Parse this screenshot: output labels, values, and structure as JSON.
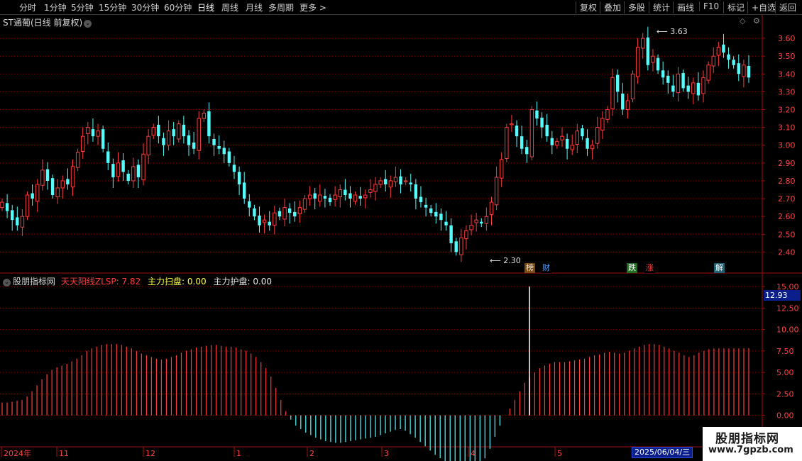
{
  "toolbar": {
    "left": [
      "分时",
      "1分钟",
      "5分钟",
      "15分钟",
      "30分钟",
      "60分钟",
      "日线",
      "周线",
      "月线",
      "多周期",
      "更多 >"
    ],
    "active": "日线",
    "right": [
      "复权",
      "叠加",
      "多股",
      "统计",
      "画线",
      "F10",
      "标记",
      "+自选",
      "返回"
    ]
  },
  "main": {
    "title": "ST通葡(日线 前复权)",
    "high_label": "3.63",
    "low_label": "2.30",
    "badges": [
      {
        "text": "榜",
        "color": "#e8e8e8",
        "bg": "#7a4a10"
      },
      {
        "text": "财",
        "color": "#4aa0ff",
        "bg": "#000"
      },
      {
        "text": "跌",
        "color": "#ffffff",
        "bg": "#1f6f1f"
      },
      {
        "text": "涨",
        "color": "#ff4040",
        "bg": "#000"
      },
      {
        "text": "解",
        "color": "#ffffff",
        "bg": "#1f5f6f"
      }
    ]
  },
  "indicator": {
    "name": "股朋指标网",
    "l1_label": "天天阳线ZLSP:",
    "l1_value": "7.82",
    "l2_label": "主力扫盘:",
    "l2_value": "0.00",
    "l3_label": "主力护盘:",
    "l3_value": "0.00",
    "current_box": "12.93"
  },
  "time_axis": {
    "labels": [
      "2024年",
      "11",
      "12",
      "1",
      "2",
      "3",
      "4",
      "5"
    ],
    "cursor_date": "2025/06/04/三"
  },
  "watermark": {
    "title": "股朋指标网",
    "url": "www.7gpzb.com"
  },
  "colors": {
    "up": "#ff3c3c",
    "down": "#54fcfc",
    "grid": "#8b0000",
    "spike": "#ffffff"
  },
  "chart_data": [
    {
      "type": "candlestick",
      "title": "ST通葡(日线 前复权)",
      "y_ticks": [
        2.4,
        2.5,
        2.6,
        2.7,
        2.8,
        2.9,
        3.0,
        3.1,
        3.2,
        3.3,
        3.4,
        3.5,
        3.6
      ],
      "ylim": [
        2.29,
        3.68
      ],
      "max_point": 3.63,
      "min_point": 2.3,
      "close": [
        2.68,
        2.63,
        2.58,
        2.55,
        2.6,
        2.72,
        2.7,
        2.78,
        2.86,
        2.8,
        2.72,
        2.76,
        2.8,
        2.78,
        2.88,
        2.96,
        3.05,
        3.1,
        3.05,
        3.08,
        2.98,
        2.9,
        2.82,
        2.9,
        2.85,
        2.8,
        2.88,
        2.82,
        2.95,
        3.05,
        3.1,
        3.05,
        3.0,
        3.08,
        3.05,
        3.12,
        3.05,
        3.0,
        2.98,
        3.15,
        3.18,
        3.05,
        3.0,
        2.98,
        2.95,
        2.9,
        2.85,
        2.78,
        2.7,
        2.65,
        2.6,
        2.55,
        2.58,
        2.55,
        2.62,
        2.6,
        2.65,
        2.62,
        2.6,
        2.65,
        2.7,
        2.72,
        2.7,
        2.72,
        2.7,
        2.68,
        2.72,
        2.75,
        2.72,
        2.7,
        2.72,
        2.7,
        2.72,
        2.75,
        2.78,
        2.8,
        2.78,
        2.8,
        2.82,
        2.78,
        2.8,
        2.78,
        2.7,
        2.68,
        2.65,
        2.62,
        2.6,
        2.58,
        2.55,
        2.45,
        2.4,
        2.48,
        2.52,
        2.55,
        2.58,
        2.56,
        2.6,
        2.68,
        2.82,
        2.92,
        3.1,
        3.12,
        3.05,
        2.98,
        2.95,
        3.2,
        3.15,
        3.1,
        3.05,
        3.0,
        3.02,
        3.05,
        2.98,
        3.0,
        3.08,
        3.05,
        2.98,
        3.0,
        3.1,
        3.15,
        3.2,
        3.38,
        3.3,
        3.2,
        3.25,
        3.4,
        3.55,
        3.6,
        3.45,
        3.5,
        3.42,
        3.38,
        3.35,
        3.3,
        3.4,
        3.32,
        3.3,
        3.35,
        3.28,
        3.38,
        3.45,
        3.5,
        3.55,
        3.52,
        3.48,
        3.45,
        3.4,
        3.45,
        3.38
      ]
    },
    {
      "type": "bar",
      "title": "股朋指标网",
      "y_ticks": [
        0.0,
        2.5,
        5.0,
        7.5,
        10.0,
        12.5,
        15.0
      ],
      "ylim": [
        -3.5,
        15.5
      ],
      "spike_value": 15.0,
      "values": [
        1.5,
        1.5,
        1.6,
        1.7,
        1.8,
        2.2,
        2.8,
        3.5,
        4.2,
        4.8,
        5.3,
        5.6,
        5.8,
        6.0,
        6.3,
        6.6,
        7.0,
        7.5,
        7.8,
        8.0,
        8.2,
        8.3,
        8.3,
        8.3,
        8.2,
        8.0,
        7.8,
        7.5,
        7.2,
        7.0,
        6.8,
        6.6,
        6.5,
        6.6,
        6.8,
        7.0,
        7.3,
        7.5,
        7.7,
        7.9,
        8.0,
        8.1,
        8.2,
        8.2,
        8.1,
        8.0,
        8.0,
        7.9,
        7.7,
        7.5,
        7.2,
        6.8,
        6.2,
        5.5,
        4.5,
        3.2,
        1.8,
        0.5,
        -0.5,
        -1.2,
        -1.6,
        -2.0,
        -2.3,
        -2.6,
        -2.8,
        -3.0,
        -3.1,
        -3.2,
        -3.2,
        -3.1,
        -3.0,
        -2.9,
        -2.8,
        -2.7,
        -2.6,
        -2.5,
        -2.3,
        -2.1,
        -1.9,
        -1.7,
        -1.6,
        -1.8,
        -2.2,
        -2.6,
        -3.1,
        -3.6,
        -4.1,
        -4.6,
        -5.0,
        -5.4,
        -5.8,
        -6.1,
        -6.3,
        -6.4,
        -6.4,
        -6.2,
        -5.8,
        -5.0,
        -3.9,
        -2.5,
        -1.2,
        0.0,
        0.8,
        1.8,
        2.8,
        3.8,
        4.5,
        5.0,
        5.5,
        5.8,
        6.0,
        6.2,
        6.2,
        6.2,
        6.3,
        6.4,
        6.5,
        6.6,
        6.8,
        7.0,
        7.1,
        7.3,
        7.4,
        7.3,
        7.2,
        7.3,
        7.5,
        7.8,
        8.0,
        8.2,
        8.3,
        8.3,
        8.2,
        8.0,
        7.8,
        7.5,
        7.3,
        7.0,
        6.8,
        7.0,
        7.3,
        7.5,
        7.7,
        7.8,
        7.8,
        7.8,
        7.8,
        7.8,
        7.8,
        7.8,
        7.82
      ]
    }
  ]
}
